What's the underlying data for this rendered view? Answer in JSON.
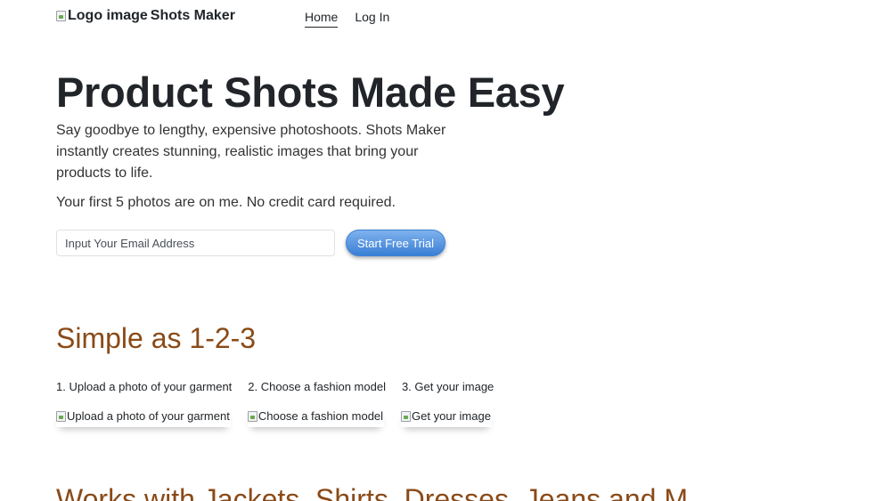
{
  "header": {
    "logo_alt": "Logo image",
    "brand_name": "Shots Maker",
    "nav": [
      {
        "label": "Home",
        "active": true
      },
      {
        "label": "Log In",
        "active": false
      }
    ]
  },
  "hero": {
    "title": "Product Shots Made Easy",
    "description": "Say goodbye to lengthy, expensive photoshoots. Shots Maker instantly creates stunning, realistic images that bring your products to life.",
    "note": "Your first 5 photos are on me. No credit card required.",
    "email_placeholder": "Input Your Email Address",
    "cta_label": "Start Free Trial"
  },
  "steps_section": {
    "title": "Simple as 1-2-3",
    "steps": [
      "1. Upload a photo of your garment",
      "2. Choose a fashion model",
      "3. Get your image"
    ],
    "image_alts": [
      "Upload a photo of your garment",
      "Choose a fashion model",
      "Get your image"
    ]
  },
  "next_section": {
    "title_visible": "Works with Jackets, Shirts, Dresses, Jeans and M"
  },
  "colors": {
    "accent": "#8a4a17",
    "button": "#3a7fd5",
    "text": "#212529"
  }
}
